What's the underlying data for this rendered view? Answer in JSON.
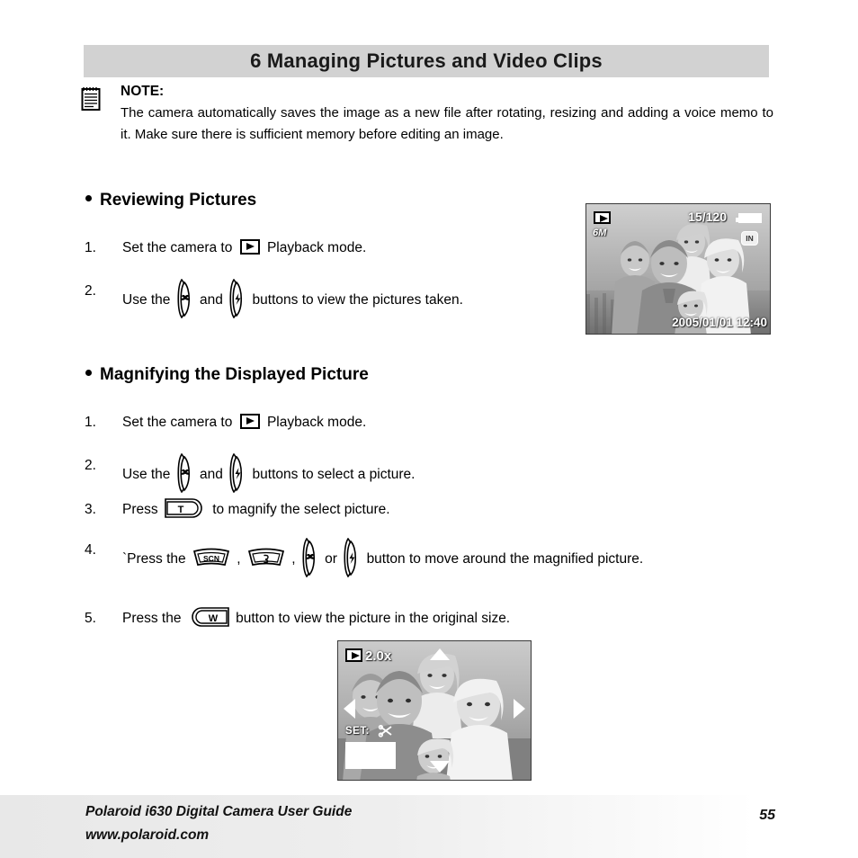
{
  "chapter": {
    "title": "6 Managing Pictures and Video Clips"
  },
  "note": {
    "icon": "notepad-icon",
    "title": "NOTE:",
    "text": "The camera automatically saves the image as a new file after rotating, resizing and adding a voice memo to it. Make sure there is sufficient memory before editing an image."
  },
  "sections": [
    {
      "heading": "Reviewing Pictures",
      "steps": [
        {
          "number": "1.",
          "before": "Set the camera to",
          "icon": "playback-mode-icon",
          "after": "Playback mode."
        },
        {
          "number": "2.",
          "part1": "Use the",
          "icon1": "macro-down-button-icon",
          "part2": "and",
          "icon2": "flash-up-button-icon",
          "part3": "buttons to view the pictures taken."
        }
      ]
    },
    {
      "heading": "Magnifying the Displayed Picture",
      "steps": [
        {
          "number": "1.",
          "before": "Set the camera to",
          "icon": "playback-mode-icon",
          "after": "Playback mode."
        },
        {
          "number": "2.",
          "part1": "Use the",
          "icon1": "macro-down-button-icon",
          "part2": "and",
          "icon2": "flash-up-button-icon",
          "part3": "buttons to select a picture."
        },
        {
          "number": "3.",
          "before": "Press",
          "icon": "zoom-tele-button-icon",
          "icon_label": "T",
          "after": "to magnify the select picture."
        },
        {
          "number": "4.",
          "part1": "`Press the",
          "icon1": "scn-button-icon",
          "icon1_label": "SCN",
          "sep1": ",",
          "icon2": "self-timer-button-icon",
          "sep2": ",",
          "icon3": "macro-down-button-icon",
          "part2": "or",
          "icon4": "flash-up-button-icon",
          "part3": "button to move around the magnified picture."
        },
        {
          "number": "5.",
          "before": "Press the",
          "icon": "zoom-wide-button-icon",
          "icon_label": "W",
          "after": "button to view the picture in the original size."
        }
      ]
    }
  ],
  "lcd_playback": {
    "name": "playback-preview-screen",
    "mode_icon": "playback-mode-icon",
    "resolution": "6M",
    "counter": "15/120",
    "battery_icon": "battery-full-icon",
    "memory_badge": "IN",
    "datestamp": "2005/01/01 12:40"
  },
  "lcd_magnified": {
    "name": "magnified-preview-screen",
    "mode_icon": "playback-mode-icon",
    "zoom_level": "2.0x",
    "set_label": "SET:",
    "set_icon": "scissors-trim-icon",
    "arrow_up_icon": "arrow-up-icon",
    "arrow_down_icon": "arrow-down-icon",
    "arrow_left_icon": "arrow-left-icon",
    "arrow_right_icon": "arrow-right-icon",
    "nav_box_icon": "navigation-box-icon"
  },
  "footer": {
    "line1": "Polaroid i630 Digital Camera User Guide",
    "line2": "www.polaroid.com",
    "page": "55"
  },
  "colors": {
    "header_bar": "#d2d2d2",
    "text": "#000000",
    "footer_gradient_start": "#e8e8e8"
  }
}
